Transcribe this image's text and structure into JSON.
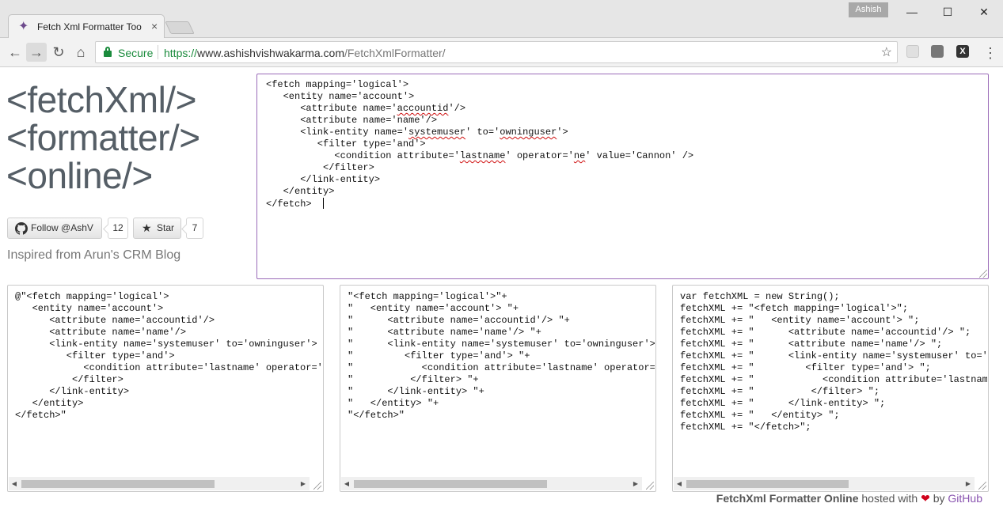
{
  "browser": {
    "tab_title": "Fetch Xml Formatter Too",
    "tab_close": "×",
    "profile_name": "Ashish",
    "window_minimize": "—",
    "window_maximize": "☐",
    "window_close": "✕",
    "back": "←",
    "forward": "→",
    "reload": "↻",
    "home": "⌂",
    "secure_label": "Secure",
    "url_scheme": "https://",
    "url_host": "www.ashishvishwakarma.com",
    "url_path": "/FetchXmlFormatter/",
    "bookmark_star": "☆",
    "menu": "⋮",
    "extension_x_label": "X",
    "accent_secure": "#1a8b3c"
  },
  "page": {
    "logo_lines": [
      "<fetchXml/>",
      "<formatter/>",
      "<online/>"
    ],
    "github": {
      "follow_label": "Follow @AshV",
      "follow_count": "12",
      "star_label": "Star",
      "star_count": "7"
    },
    "inspired_text": "Inspired from Arun's CRM Blog",
    "footer": {
      "name": "FetchXml Formatter Online",
      "hosted": " hosted with ",
      "heart": "❤",
      "by": " by ",
      "link": "GitHub"
    }
  },
  "editor": {
    "lines": [
      "<fetch mapping='logical'>",
      "   <entity name='account'>",
      "      <attribute name='accountid'/>",
      "      <attribute name='name'/>",
      "      <link-entity name='systemuser' to='owninguser'>",
      "         <filter type='and'>",
      "            <condition attribute='lastname' operator='ne' value='Cannon' />",
      "          </filter>",
      "      </link-entity>",
      "   </entity>",
      "</fetch>"
    ]
  },
  "outputs": {
    "csharp_verbatim": "@\"<fetch mapping='logical'>\n   <entity name='account'>\n      <attribute name='accountid'/>\n      <attribute name='name'/>\n      <link-entity name='systemuser' to='owninguser'>\n         <filter type='and'>\n            <condition attribute='lastname' operator='ne' value='Cannon' />\n          </filter>\n      </link-entity>\n   </entity>\n</fetch>\"",
    "concatenated": "\"<fetch mapping='logical'>\"+\n\"   <entity name='account'> \"+\n\"      <attribute name='accountid'/> \"+\n\"      <attribute name='name'/> \"+\n\"      <link-entity name='systemuser' to='owninguser'> \"+\n\"         <filter type='and'> \"+\n\"            <condition attribute='lastname' operator='ne' value='Cannon' /> \"+\n\"          </filter> \"+\n\"      </link-entity> \"+\n\"   </entity> \"+\n\"</fetch>\"",
    "javascript": "var fetchXML = new String();\nfetchXML += \"<fetch mapping='logical'>\";\nfetchXML += \"   <entity name='account'> \";\nfetchXML += \"      <attribute name='accountid'/> \";\nfetchXML += \"      <attribute name='name'/> \";\nfetchXML += \"      <link-entity name='systemuser' to='owninguser'> \";\nfetchXML += \"         <filter type='and'> \";\nfetchXML += \"            <condition attribute='lastname' operator='ne' value='Cannon' /> \";\nfetchXML += \"          </filter> \";\nfetchXML += \"      </link-entity> \";\nfetchXML += \"   </entity> \";\nfetchXML += \"</fetch>\";"
  }
}
